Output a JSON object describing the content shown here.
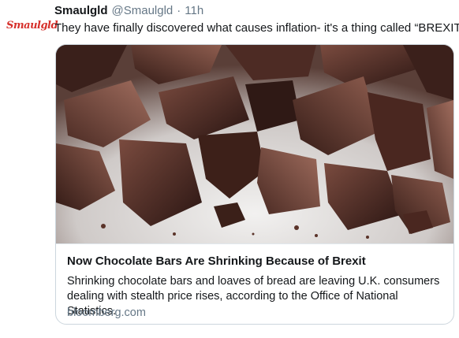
{
  "author": {
    "logo_text": "Smaulgld",
    "display_name": "Smaulgld",
    "handle": "@Smaulgld",
    "separator": "·",
    "time": "11h"
  },
  "tweet": {
    "text": "They have finally discovered what causes inflation- it's a thing called “BREXIT”"
  },
  "card": {
    "image_subject": "chocolate-pieces",
    "title": "Now Chocolate Bars Are Shrinking Because of Brexit",
    "description": "Shrinking chocolate bars and loaves of bread are leaving U.K. consumers dealing with stealth price rises, according to the Office of National Statistics.",
    "domain": "bloomberg.com"
  },
  "colors": {
    "logo_red": "#d6302b",
    "secondary_text": "#657786",
    "card_border": "#ccd6dd"
  }
}
